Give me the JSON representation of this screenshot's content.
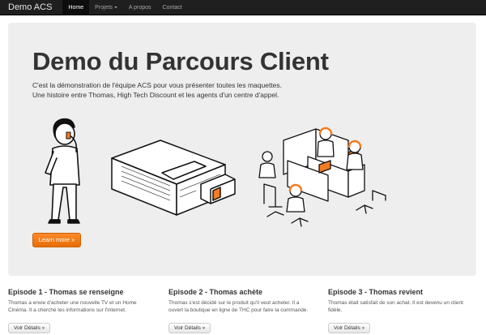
{
  "navbar": {
    "brand": "Demo ACS",
    "items": [
      {
        "label": "Home"
      },
      {
        "label": "Projets"
      },
      {
        "label": "A propos"
      },
      {
        "label": "Contact"
      }
    ]
  },
  "hero": {
    "title": "Demo du Parcours Client",
    "lead_line1": "C'est la démonstration de l'équipe ACS pour vous présenter toutes les maquettes.",
    "lead_line2": "Une histoire entre Thomas, High Tech Discount et les agents d'un centre d'appel.",
    "button_label": "Learn more »"
  },
  "colors": {
    "accent": "#f47b20",
    "hero_bg": "#eeeeee",
    "navbar_bg": "#1f1f1f"
  },
  "episodes": [
    {
      "title": "Episode 1 - Thomas se renseigne",
      "text_line1": "Thomas a envie d'acheter une nouvelle TV et un Home",
      "text_line2": "Cinéma. Il a cherché les informations sur l'internet.",
      "button_label": "Voir Détails »"
    },
    {
      "title": "Episode 2 - Thomas achète",
      "text_line1": "Thomas s'est décidé sur le produit qu'il veut acheter. Il a",
      "text_line2": "ouvert la boutique en ligne de THC pour faire la commande.",
      "button_label": "Voir Détails »"
    },
    {
      "title": "Episode 3 - Thomas revient",
      "text_line1": "Thomas était satisfait de son achat. Il est devenu un client",
      "text_line2": "fidèle.",
      "button_label": "Voir Détails »"
    }
  ]
}
